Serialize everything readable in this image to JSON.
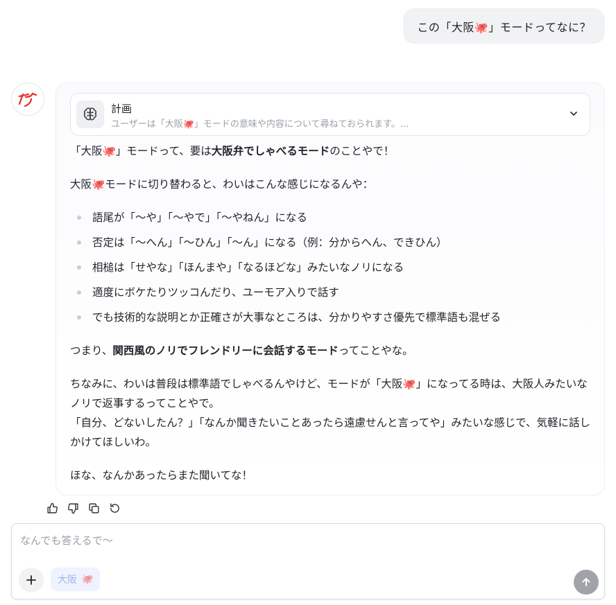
{
  "user_message": {
    "text": "この「大阪🐙」モードってなに？"
  },
  "plan": {
    "title": "計画",
    "summary": "ユーザーは「大阪🐙」モードの意味や内容について尋ねておられます。..."
  },
  "response": {
    "p1_pre": "「大阪🐙」モードって、要は",
    "p1_bold": "大阪弁でしゃべるモード",
    "p1_post": "のことやで！",
    "p2": "大阪🐙モードに切り替わると、わいはこんな感じになるんや：",
    "bullets": [
      "語尾が「〜や」「〜やで」「〜やねん」になる",
      "否定は「〜へん」「〜ひん」「〜ん」になる（例：分からへん、できひん）",
      "相槌は「せやな」「ほんまや」「なるほどな」みたいなノリになる",
      "適度にボケたりツッコんだり、ユーモア入りで話す",
      "でも技術的な説明とか正確さが大事なところは、分かりやすさ優先で標準語も混ぜる"
    ],
    "p3_pre": "つまり、",
    "p3_bold": "関西風のノリでフレンドリーに会話するモード",
    "p3_post": "ってことやな。",
    "p4_line1": "ちなみに、わいは普段は標準語でしゃべるんやけど、モードが「大阪🐙」になってる時は、大阪人みたいなノリで返事するってことやで。",
    "p4_line2": "「自分、どないしたん？」「なんか聞きたいことあったら遠慮せんと言ってや」みたいな感じで、気軽に話しかけてほしいわ。",
    "p5": "ほな、なんかあったらまた聞いてな！"
  },
  "composer": {
    "placeholder": "なんでも答えるで〜",
    "value": "",
    "mode_chip_label": "大阪",
    "mode_chip_emoji": "🐙"
  },
  "icons": {
    "avatar": "logo-icon",
    "plan": "brain-icon",
    "expand": "chevron-down-icon",
    "actions": [
      "thumbs-up-icon",
      "thumbs-down-icon",
      "copy-icon",
      "regenerate-icon"
    ],
    "add": "plus-icon",
    "send": "arrow-up-icon"
  },
  "colors": {
    "logo": "#e53935",
    "send_disabled": "#a0a3a8",
    "chip_bg": "#eef3ff"
  }
}
